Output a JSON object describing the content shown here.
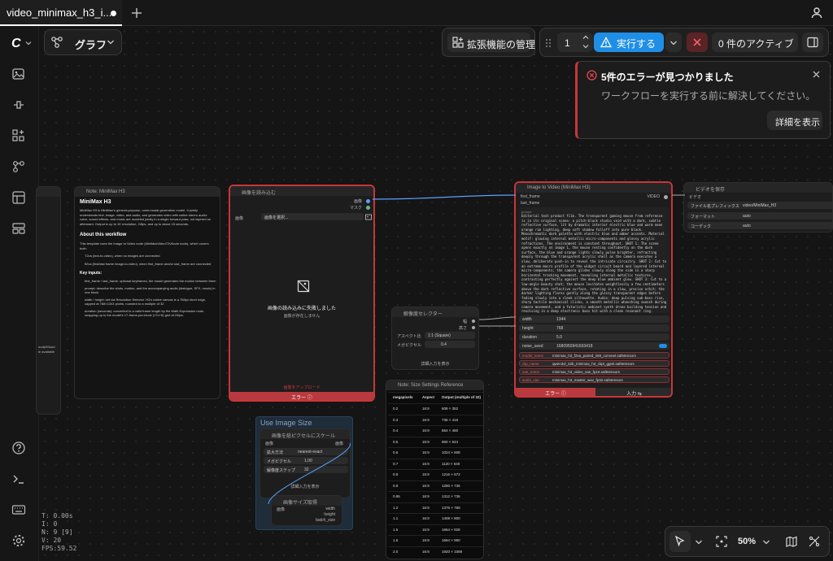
{
  "tab": {
    "title": "video_minimax_h3_i..."
  },
  "toolbar": {
    "graph_label": "グラフ",
    "ext_label": "拡張機能の管理",
    "queue_count": "1",
    "run_label": "実行する",
    "active_label": "0 件のアクティブ"
  },
  "error_toast": {
    "title": "5件のエラーが見つかりました",
    "message": "ワークフローを実行する前に解決してください。",
    "details_button": "詳細を表示"
  },
  "stats": {
    "t": "T: 0.00s",
    "i": "I: 0",
    "n": "N: 9 [9]",
    "v": "V: 20",
    "fps": "FPS:59.52"
  },
  "zoom": {
    "level": "50%"
  },
  "note_node": {
    "title": "Note: MiniMax H3",
    "heading": "MiniMax H3",
    "intro": "MiniMax H3 is MiniMax's general-purpose, omni-modal generation model. It jointly understands text, image, video, and audio, and generates video with native stereo audio: voice, sound effects, and music are modeled jointly in a single forward pass, not layered on afterward. Output is up to 1K resolution, 24fps, and up to about 15 seconds.",
    "about_heading": "About this workflow",
    "about_text": "This template uses the Image to Video node (MiniMaxVideoT2vNode node), which covers both:",
    "bullet1": "T2va (text-to-video), when no images are connected",
    "bullet2": "fl2va (first/last frame image-to-video), when first_frame and/or last_frame are connected",
    "key_heading": "Key inputs:",
    "k1": "first_frame / last_frame: optional keyframes, the model generates the motion between them",
    "k2": "prompt: describe the shots, motion, and the accompanying audio (dialogue, SFX, music) in one block",
    "k3": "width / height: set via Resolution Selector. H3's native canvas is a 768px short edge, capped at 768×1344 pixels, rounded to a multiple of 32",
    "k4": "duration (seconds): converted to a valid frame length by the Math Expression node, snapping up to the model's 17-frame-per-block (17n+8) grid at 24fps."
  },
  "load_node": {
    "title": "画像を読み込む",
    "out1": "画像",
    "out2": "マスク",
    "image_label": "画像",
    "image_value": "画像を選択...",
    "fail_title": "画像の読み込みに失敗しました",
    "fail_sub": "画像が存在しません",
    "link_text": "画像をアップロード",
    "error_label": "エラー"
  },
  "res_node": {
    "title": "解像度セレクター",
    "out1": "幅",
    "out2": "高さ",
    "aspect_label": "アスペクト比",
    "aspect_value": "1:1 (Square)",
    "mp_label": "メガピクセル",
    "mp_value": "0.4",
    "advanced": "詳細入力を表示"
  },
  "ref_node": {
    "title": "Note: Size Settings Reference",
    "headers": [
      "megapixels",
      "Aspect",
      "Output (multiple of 32)"
    ],
    "rows": [
      [
        "0.2",
        "16:9",
        "608 × 352"
      ],
      [
        "0.3",
        "16:9",
        "736 × 416"
      ],
      [
        "0.4",
        "16:9",
        "864 × 480"
      ],
      [
        "0.5",
        "16:9",
        "960 × 544"
      ],
      [
        "0.6",
        "16:9",
        "1024 × 608"
      ],
      [
        "0.7",
        "16:9",
        "1120 × 640"
      ],
      [
        "0.8",
        "16:9",
        "1216 × 672"
      ],
      [
        "0.9",
        "16:9",
        "1280 × 736"
      ],
      [
        "0.95",
        "16:9",
        "1312 × 736"
      ],
      [
        "1.2",
        "16:9",
        "1376 × 768"
      ],
      [
        "1.1",
        "16:9",
        "1408 × 800"
      ],
      [
        "1.5",
        "16:9",
        "1664 × 928"
      ],
      [
        "1.6",
        "16:9",
        "1664 × 960"
      ],
      [
        "2.0",
        "16:9",
        "1920 × 1088"
      ]
    ]
  },
  "i2v_node": {
    "title": "Image to Video (MiniMax H3)",
    "in1": "first_frame",
    "in2": "last_frame",
    "out1": "VIDEO",
    "prompt_label": "prompt",
    "prompt_text": "Editorial tech product film. The transparent gaming mouse from reference is in its original scene: a pitch-black studio void with a dark, subtle reflective surface, lit by dramatic interior electric blue and warm neon orange rim lighting, deep soft shadow falloff into pure black. Monochromatic dark palette with electric blue and amber accents. Material motif: glowing internal metallic micro-components and glossy acrylic refractions. The environment is constant throughout. SHOT 1: The scene opens exactly on image 1, the mouse resting confidently on the dark surface, the blue and orange lights slowly pulse brighter, refracting deeply through the transparent acrylic shell as the camera executes a slow, deliberate push-in to reveal the intricate circuitry. SHOT 2: Cut to an extreme macro profile of the widget circuit board and layered internal micro-components; the camera glides slowly along the side in a sharp horizontal tracking movement, revealing internal metallic textures, contrasting perfectly against the deep blue ambient glow. SHOT 3: Cut to a low-angle beauty shot; the mouse levitates weightlessly a few centimeters above the dark reflective surface, rotating in a slow, precise orbit; the darker lighting flares gently along the glossy transparent edges before fading slowly into a sleek silhouette. Audio: deep pulsing sub-bass rise, sharp tactile mechanical clicks, a smooth metallic whooshing swoosh during camera movement, and a futuristic ambient synth drone building tension and resolving in a deep electronic bass hit with a clean resonant ring.",
    "width_label": "width",
    "width_value": "1344",
    "height_label": "height",
    "height_value": "768",
    "duration_label": "duration",
    "duration_value": "5.0",
    "seed_label": "noise_seed",
    "seed_value": "1680950941693418",
    "r1_label": "model_name",
    "r1_value": "minimax_h3_f2va_paired_int8_convnet.safetensors",
    "r2_label": "clip_name",
    "r2_value": "qwen3vl_22b_minimax_h3_ckpt_ggml.safetensors",
    "r3_label": "vae_name",
    "r3_value": "minimax_h3_video_vae_fp16.safetensors",
    "r4_label": "audio_vae",
    "r4_value": "minimax_h3_master_wav_fp32.safetensors",
    "error_label": "エラー",
    "input_label": "入力"
  },
  "save_node": {
    "title": "ビデオを保存",
    "in1": "ビデオ",
    "prefix_label": "ファイル名プレフィックス",
    "prefix_value": "video/MiniMax_H3",
    "format_label": "フォーマット",
    "format_value": "auto",
    "codec_label": "コーデック",
    "codec_value": "auto"
  },
  "use_node": {
    "group_title": "Use Image Size",
    "scale_title": "画像を総ピクセルにスケール",
    "in1": "画像",
    "out1": "画像",
    "method_label": "拡大方法",
    "method_value": "nearest-exact",
    "mp_label": "メガピクセル",
    "mp_value": "1.00",
    "step_label": "解像度ステップ",
    "step_value": "32",
    "advanced": "詳細入力を表示",
    "size_title": "画像サイズ取得",
    "size_in": "画像",
    "o1": "width",
    "o2": "height",
    "o3": "batch_size"
  },
  "left_node": {
    "text1": "uudplGloud",
    "text2": "le available"
  },
  "colors": {
    "accent": "#1f8fe6",
    "error": "#c8363a",
    "error_bg": "#b93a3e"
  }
}
